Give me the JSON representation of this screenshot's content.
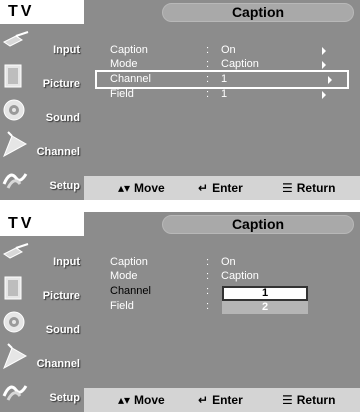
{
  "tv_label": "TV",
  "menu_title": "Caption",
  "sidebar": {
    "items": [
      {
        "label": "Input",
        "icon": "input-icon"
      },
      {
        "label": "Picture",
        "icon": "picture-icon"
      },
      {
        "label": "Sound",
        "icon": "sound-icon"
      },
      {
        "label": "Channel",
        "icon": "channel-icon"
      },
      {
        "label": "Setup",
        "icon": "setup-icon"
      }
    ]
  },
  "colors": {
    "panel": "#8c8c8c",
    "footer": "#d4d4d4",
    "text": "#ffffff"
  },
  "screen1": {
    "rows": [
      {
        "label": "Caption",
        "colon": ":",
        "value": "On"
      },
      {
        "label": "Mode",
        "colon": ":",
        "value": "Caption"
      },
      {
        "label": "Channel",
        "colon": ":",
        "value": "1"
      },
      {
        "label": "Field",
        "colon": ":",
        "value": "1"
      }
    ]
  },
  "screen2": {
    "rows": [
      {
        "label": "Caption",
        "colon": ":",
        "value": "On"
      },
      {
        "label": "Mode",
        "colon": ":",
        "value": "Caption"
      },
      {
        "label": "Channel",
        "colon": ":"
      },
      {
        "label": "Field",
        "colon": ":"
      }
    ],
    "dropdown": [
      "1",
      "2"
    ]
  },
  "footer": {
    "move": "Move",
    "enter": "Enter",
    "return": "Return"
  }
}
